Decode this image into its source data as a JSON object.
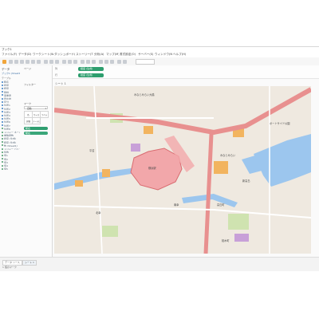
{
  "window": {
    "app_title": "ブック1",
    "menus": [
      "ファイル(F)",
      "データ(D)",
      "ワークシート(W)",
      "ダッシュボード(B)",
      "ストーリー(T)",
      "分析(A)",
      "マップ(M)",
      "書式設定(O)",
      "サーバー(S)",
      "ウィンドウ(N)",
      "ヘルプ(H)"
    ]
  },
  "data_pane": {
    "title": "データ",
    "source": "ブック1 (Sheet1)",
    "section_dimensions": "テーブル",
    "fields": [
      "駅名",
      "緯度",
      "経度",
      "路線",
      "事業者",
      "所在地",
      "区分",
      "住所1",
      "住所2",
      "住所3",
      "住所4",
      "住所5",
      "住所6",
      "住所7",
      "住所8",
      "メジャー ネーム",
      "乗降者数",
      "緯度 (生成)",
      "経度 (生成)",
      "数 (Sheet1)",
      "メジャー バリュー",
      "件数",
      "値1",
      "値2",
      "値3",
      "値4",
      "値5"
    ]
  },
  "marks_pane": {
    "pages_label": "ページ",
    "filters_label": "フィルター",
    "marks_label": "マーク",
    "mark_type": "自動",
    "buttons": [
      "色",
      "サイズ",
      "ラベル",
      "詳細",
      "ツールヒント"
    ],
    "pill": "駅名"
  },
  "shelves": {
    "columns_label": "列",
    "rows_label": "行",
    "columns_pill": "経度 (生成)",
    "rows_pill": "緯度 (生成)"
  },
  "sheet": {
    "title": "シート 1"
  },
  "map": {
    "labels": [
      "横浜駅",
      "みなとみらい",
      "高島町",
      "桜木町",
      "平沼",
      "北幸",
      "南幸",
      "新高島",
      "ポートサイド公園",
      "みなとみらい大橋"
    ],
    "colors": {
      "background": "#efe9e0",
      "water": "#9cc6ee",
      "highway": "#e8908f",
      "station_fill": "#f2a7aa",
      "park": "#cfe3b0",
      "building_orange": "#f2b45f",
      "building_purple": "#c8a0d8"
    }
  },
  "status": {
    "tabs": [
      "データ ソース",
      "シート 1"
    ],
    "info": "1 個のマーク"
  }
}
